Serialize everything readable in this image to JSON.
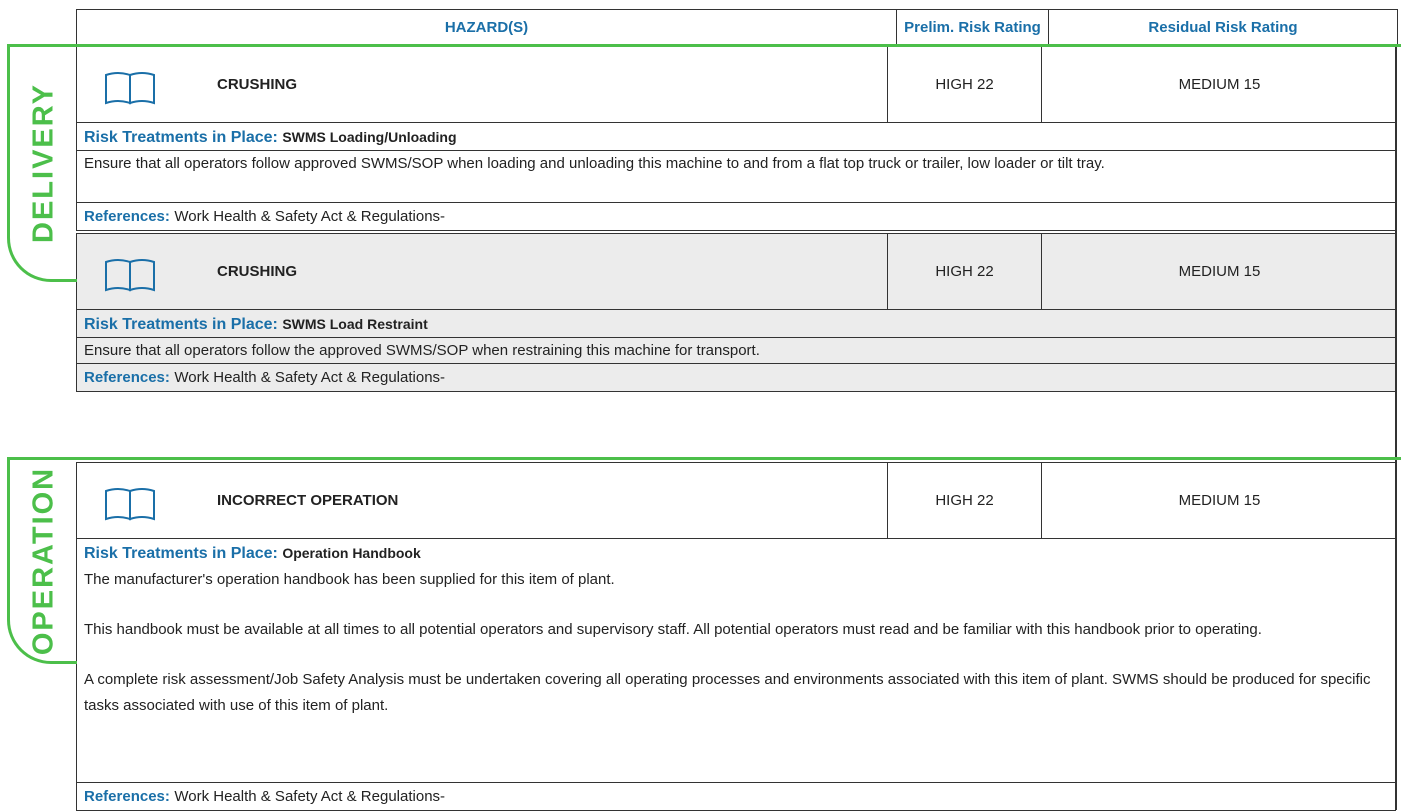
{
  "header": {
    "hazards": "HAZARD(S)",
    "prelim": "Prelim. Risk Rating",
    "residual": "Residual Risk Rating"
  },
  "sections": [
    {
      "label": "DELIVERY"
    },
    {
      "label": "OPERATION"
    }
  ],
  "hazards": [
    {
      "name": "CRUSHING",
      "prelim": "HIGH 22",
      "residual": "MEDIUM 15",
      "treatment_label": "Risk Treatments in Place:",
      "treatment_title": "SWMS Loading/Unloading",
      "description": "Ensure that all operators follow approved SWMS/SOP when loading and unloading this machine to and from a flat top truck or trailer, low loader or tilt tray.",
      "ref_label": "References:",
      "ref_value": "Work Health & Safety Act & Regulations-"
    },
    {
      "name": "CRUSHING",
      "prelim": "HIGH 22",
      "residual": "MEDIUM 15",
      "treatment_label": "Risk Treatments in Place:",
      "treatment_title": "SWMS Load Restraint",
      "description": "Ensure that all operators follow the approved SWMS/SOP when restraining this machine for transport.",
      "ref_label": "References:",
      "ref_value": "Work Health & Safety Act & Regulations-"
    },
    {
      "name": "INCORRECT OPERATION",
      "prelim": "HIGH 22",
      "residual": "MEDIUM 15",
      "treatment_label": "Risk Treatments in Place:",
      "treatment_title": "Operation Handbook",
      "description_1": "The manufacturer's operation handbook has been supplied for this item of plant.",
      "description_2": "This handbook must be available at all times to all potential operators and supervisory staff. All potential operators must read and be familiar with this handbook prior to operating.",
      "description_3": "A complete risk assessment/Job Safety Analysis must be undertaken covering all operating processes and environments associated with this item of plant. SWMS should be produced for specific tasks associated with use of this item of plant.",
      "ref_label": "References:",
      "ref_value": "Work Health & Safety Act & Regulations-"
    }
  ],
  "icons": {
    "hazard_icon": "book-icon"
  },
  "colors": {
    "accent_blue": "#1a6fa8",
    "section_green": "#4cbf4a",
    "alt_row_gray": "#ececec"
  }
}
